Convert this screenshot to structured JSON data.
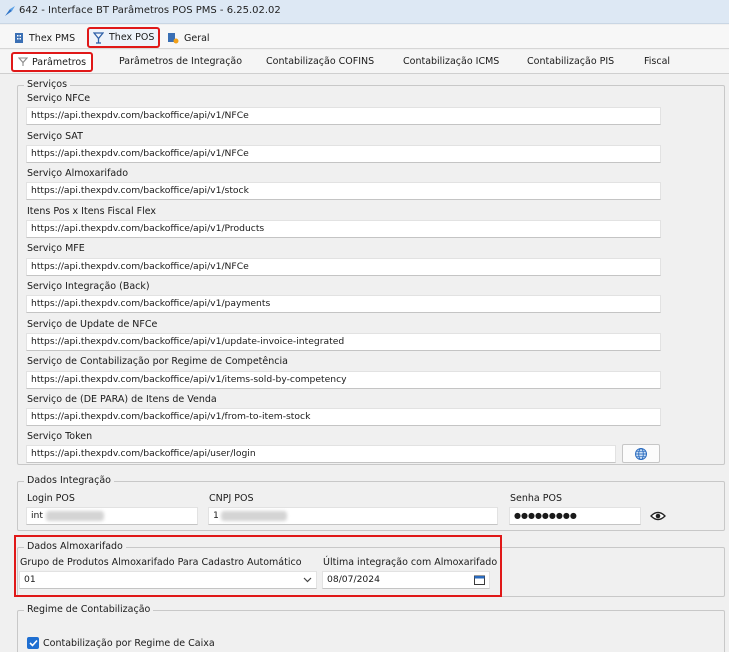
{
  "window": {
    "title": "642 - Interface BT Parâmetros POS PMS - 6.25.02.02"
  },
  "top_tabs": [
    {
      "label": "Thex PMS"
    },
    {
      "label": "Thex POS"
    },
    {
      "label": "Geral"
    }
  ],
  "sub_tabs": [
    {
      "label": "Parâmetros"
    },
    {
      "label": "Parâmetros de Integração"
    },
    {
      "label": "Contabilização COFINS"
    },
    {
      "label": "Contabilização ICMS"
    },
    {
      "label": "Contabilização PIS"
    },
    {
      "label": "Fiscal"
    }
  ],
  "servicos": {
    "legend": "Serviços",
    "fields": [
      {
        "label": "Serviço NFCe",
        "value": "https://api.thexpdv.com/backoffice/api/v1/NFCe"
      },
      {
        "label": "Serviço SAT",
        "value": "https://api.thexpdv.com/backoffice/api/v1/NFCe"
      },
      {
        "label": "Serviço Almoxarifado",
        "value": "https://api.thexpdv.com/backoffice/api/v1/stock"
      },
      {
        "label": "Itens Pos x Itens Fiscal Flex",
        "value": "https://api.thexpdv.com/backoffice/api/v1/Products"
      },
      {
        "label": "Serviço MFE",
        "value": "https://api.thexpdv.com/backoffice/api/v1/NFCe"
      },
      {
        "label": "Serviço Integração (Back)",
        "value": "https://api.thexpdv.com/backoffice/api/v1/payments"
      },
      {
        "label": "Serviço de Update de NFCe",
        "value": "https://api.thexpdv.com/backoffice/api/v1/update-invoice-integrated"
      },
      {
        "label": "Serviço de Contabilização por Regime de Competência",
        "value": "https://api.thexpdv.com/backoffice/api/v1/items-sold-by-competency"
      },
      {
        "label": "Serviço de (DE PARA) de Itens de Venda",
        "value": "https://api.thexpdv.com/backoffice/api/v1/from-to-item-stock"
      },
      {
        "label": "Serviço Token",
        "value": "https://api.thexpdv.com/backoffice/api/user/login"
      }
    ]
  },
  "dados_integracao": {
    "legend": "Dados Integração",
    "login_label": "Login POS",
    "login_value": "int",
    "cnpj_label": "CNPJ POS",
    "cnpj_value": "1",
    "senha_label": "Senha POS",
    "senha_value": "●●●●●●●●●"
  },
  "dados_almoxarifado": {
    "legend": "Dados Almoxarifado",
    "grupo_label": "Grupo de Produtos Almoxarifado Para Cadastro Automático",
    "grupo_value": "01",
    "ultima_label": "Última integração com Almoxarifado",
    "ultima_value": "08/07/2024"
  },
  "regime": {
    "legend": "Regime de Contabilização",
    "checkbox_label": "Contabilização por Regime de Caixa",
    "checkbox_checked": true
  },
  "colors": {
    "highlight": "#e01818",
    "accent": "#1f6fd1"
  }
}
